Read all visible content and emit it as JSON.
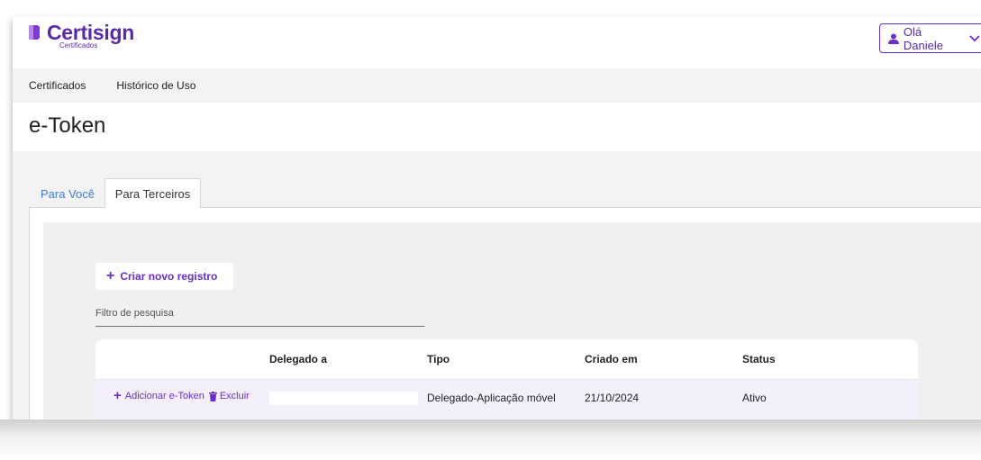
{
  "header": {
    "logo_text": "Certisign",
    "logo_subtitle": "Certificados",
    "user_greeting": "Olá Daniele"
  },
  "nav": {
    "items": [
      {
        "label": "Certificados"
      },
      {
        "label": "Histórico de Uso"
      }
    ]
  },
  "page": {
    "title": "e-Token"
  },
  "tabs": [
    {
      "label": "Para Você",
      "active": false
    },
    {
      "label": "Para Terceiros",
      "active": true
    }
  ],
  "actions": {
    "create_label": "Criar novo registro"
  },
  "filter": {
    "label": "Filtro de pesquisa"
  },
  "table": {
    "columns": [
      "",
      "Delegado a",
      "Tipo",
      "Criado em",
      "Status"
    ],
    "rows": [
      {
        "add_label": "Adicionar e-Token",
        "delete_label": "Excluir",
        "delegado": "",
        "tipo": "Delegado-Aplicação móvel",
        "criado_em": "21/10/2024",
        "status": "Ativo"
      }
    ]
  },
  "colors": {
    "brand": "#6a2dc7",
    "link": "#3f7fd6",
    "row_highlight": "#f3f0fb"
  },
  "icons": [
    "user-icon",
    "chevron-down-icon",
    "plus-icon",
    "trash-icon"
  ]
}
